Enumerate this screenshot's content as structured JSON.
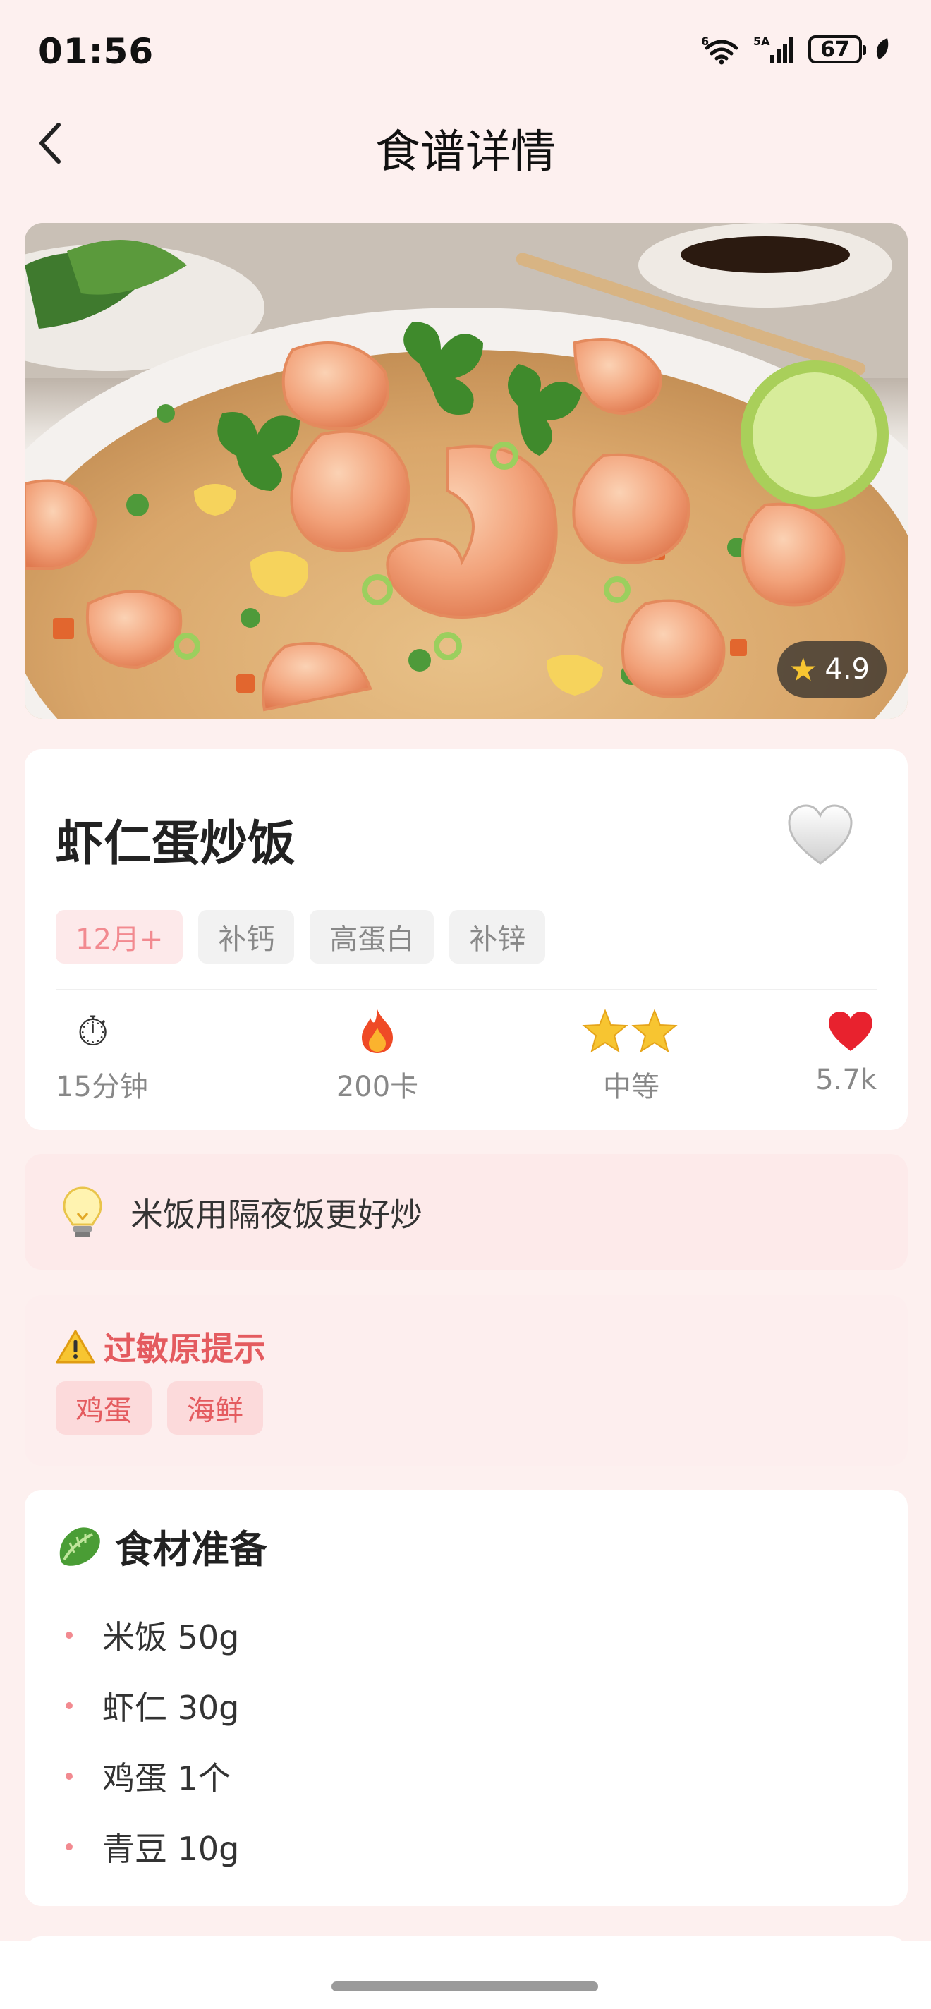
{
  "status_bar": {
    "time": "01:56",
    "battery": "67",
    "network": "5A",
    "wifi_label": "6"
  },
  "header": {
    "title": "食谱详情"
  },
  "hero": {
    "rating": "4.9"
  },
  "recipe": {
    "name": "虾仁蛋炒饭",
    "tags": [
      "12月+",
      "补钙",
      "高蛋白",
      "补锌"
    ],
    "stats": {
      "time": "15分钟",
      "calories": "200卡",
      "difficulty": "中等",
      "likes": "5.7k"
    }
  },
  "tip": {
    "text": "米饭用隔夜饭更好炒"
  },
  "allergy": {
    "title": "过敏原提示",
    "items": [
      "鸡蛋",
      "海鲜"
    ]
  },
  "ingredients": {
    "title": "食材准备",
    "items": [
      "米饭 50g",
      "虾仁 30g",
      "鸡蛋 1个",
      "青豆 10g"
    ]
  },
  "colors": {
    "background": "#fdf0ef",
    "accent_pink": "#f28a90",
    "allergy_red": "#e45b5f",
    "card": "#ffffff"
  }
}
